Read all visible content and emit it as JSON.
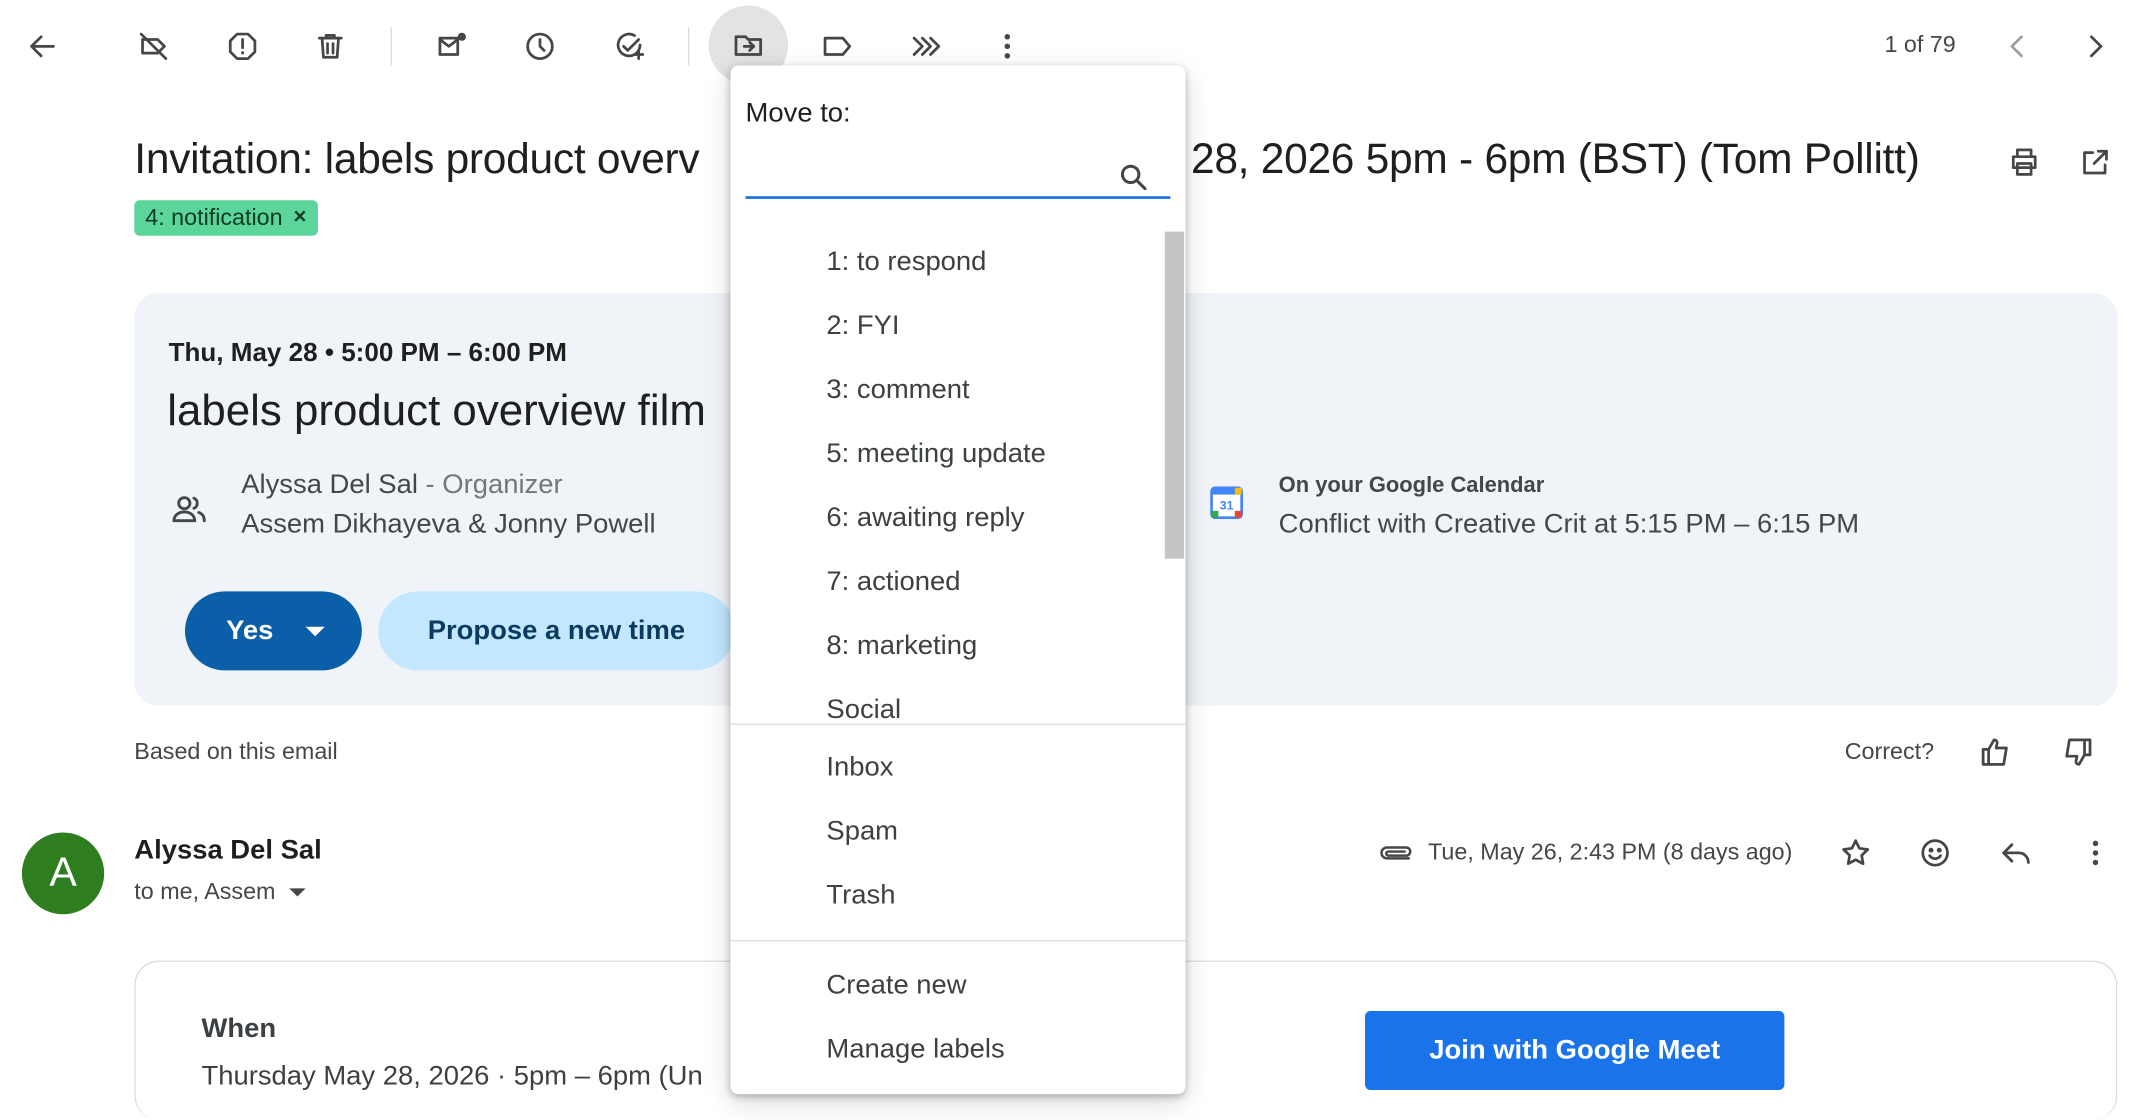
{
  "toolbar": {
    "back_icon": "arrow-left-icon",
    "icons": [
      "label-off-icon",
      "report-spam-icon",
      "delete-icon",
      "mark-unread-icon",
      "snooze-icon",
      "add-task-icon",
      "move-to-icon",
      "label-icon",
      "more-actions-icon",
      "more-vert-icon"
    ],
    "pager": "1 of 79"
  },
  "email": {
    "subject_left": "Invitation: labels product overv",
    "subject_right": "28, 2026 5pm - 6pm (BST) (Tom Pollitt)",
    "label_chip": "4: notification",
    "label_chip_remove": "×"
  },
  "invite": {
    "date": "Thu, May 28 • 5:00 PM – 6:00 PM",
    "title": "labels product overview film",
    "organizer": "Alyssa Del Sal",
    "organizer_role": " - Organizer",
    "guests": "Assem Dikhayeva & Jonny Powell",
    "yes_label": "Yes",
    "propose_label": "Propose a new time",
    "calendar_heading": "On your Google Calendar",
    "calendar_conflict": "Conflict with Creative Crit at 5:15 PM – 6:15 PM",
    "calendar_badge": "31"
  },
  "feedback": {
    "based_on": "Based on this email",
    "correct": "Correct?"
  },
  "message": {
    "avatar_letter": "A",
    "sender": "Alyssa Del Sal",
    "recipients": "to me, Assem",
    "date": "Tue, May 26, 2:43 PM (8 days ago)"
  },
  "details": {
    "when_label": "When",
    "when_value": "Thursday May 28, 2026 · 5pm – 6pm (Un",
    "meet_label": "Join with Google Meet"
  },
  "moveto": {
    "heading": "Move to:",
    "search_placeholder": "",
    "labels": [
      "1: to respond",
      "2: FYI",
      "3: comment",
      "5: meeting update",
      "6: awaiting reply",
      "7: actioned",
      "8: marketing",
      "Social"
    ],
    "system": [
      "Inbox",
      "Spam",
      "Trash"
    ],
    "actions": [
      "Create new",
      "Manage labels"
    ]
  },
  "colors": {
    "label_chip": "#5cd59b",
    "yes_button": "#0b5ea8",
    "propose_button": "#c2e7ff",
    "meet_button": "#1a73e8",
    "avatar": "#2e7d1f",
    "card_bg": "#f0f3f7"
  }
}
